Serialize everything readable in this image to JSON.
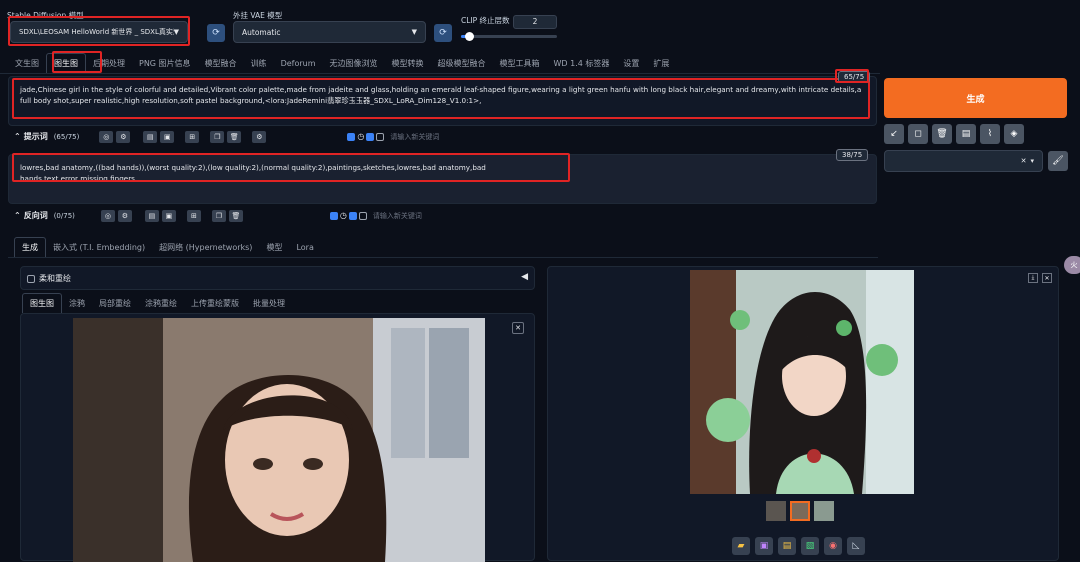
{
  "header": {
    "model_label": "Stable Diffusion 模型",
    "model_value": "SDXL\\LEOSAM HelloWorld 新世界 _ SDXL真实派",
    "vae_label": "外挂 VAE 模型",
    "vae_value": "Automatic",
    "clip_label": "CLIP 终止层数",
    "clip_value": "2",
    "clip_fraction": 0.083
  },
  "main_tabs": [
    "文生图",
    "图生图",
    "后期处理",
    "PNG 图片信息",
    "模型融合",
    "训练",
    "Deforum",
    "无边图像浏览",
    "模型转换",
    "超级模型融合",
    "模型工具箱",
    "WD 1.4 标签器",
    "设置",
    "扩展"
  ],
  "prompt": {
    "text": "jade,Chinese girl in the style of colorful and detailed,Vibrant color palette,made from jadeite and glass,holding an emerald leaf-shaped figure,wearing a light green hanfu with long black hair,elegant and dreamy,with intricate details,a full body shot,super realistic,high resolution,soft pastel background,<lora:JadeRemini翡翠珍玉玉器_SDXL_LoRA_Dim128_V1.0:1>,",
    "counter": "65/75",
    "label": "提示词",
    "count": "(65/75)",
    "keyword_placeholder": "请输入新关键词"
  },
  "negative": {
    "text": "lowres,bad anatomy,((bad hands)),(worst quality:2),(low quality:2),(normal quality:2),paintings,sketches,lowres,bad anatomy,bad hands,text,error,missing fingers,",
    "counter": "38/75",
    "label": "反向词",
    "count": "(0/75)",
    "keyword_placeholder": "请输入新关键词"
  },
  "generate_label": "生成",
  "sub_tabs": [
    "生成",
    "嵌入式 (T.I. Embedding)",
    "超网络 (Hypernetworks)",
    "模型",
    "Lora"
  ],
  "soft_inpaint_label": "柔和重绘",
  "img_tabs": [
    "图生图",
    "涂鸦",
    "局部重绘",
    "涂鸦重绘",
    "上传重绘蒙版",
    "批量处理"
  ],
  "colors": {
    "accent": "#f36c21",
    "highlight": "#e02424",
    "bg": "#0b0f19",
    "input": "#1f2937"
  }
}
